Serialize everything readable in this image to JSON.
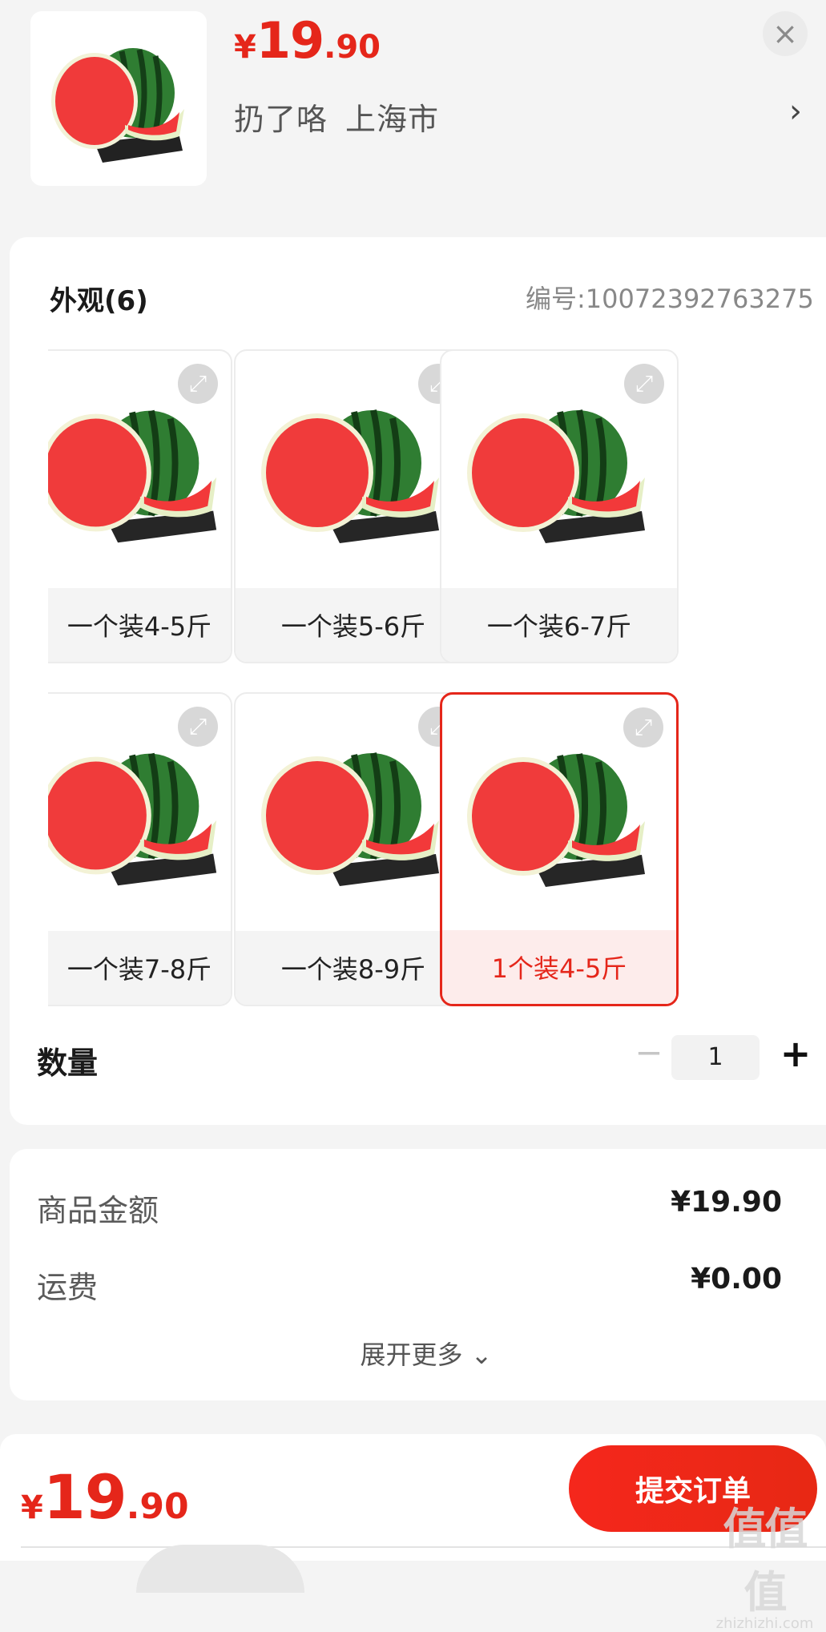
{
  "header": {
    "price": {
      "currency": "¥",
      "integer": "19",
      "decimal": ".90"
    },
    "address": {
      "name": "扔了咯",
      "city": "上海市"
    },
    "chevron": "›",
    "close": "×"
  },
  "variants": {
    "title": "外观(6)",
    "sku": "编号:100723927632​75",
    "items": [
      {
        "label": "一个装4-5斤",
        "selected": false
      },
      {
        "label": "一个装5-6斤",
        "selected": false
      },
      {
        "label": "一个装6-7斤",
        "selected": false
      },
      {
        "label": "一个装7-8斤",
        "selected": false
      },
      {
        "label": "一个装8-9斤",
        "selected": false
      },
      {
        "label": "1个装4-5斤",
        "selected": true
      }
    ],
    "expand_icon": "⤢"
  },
  "quantity": {
    "label": "数量",
    "value": "1",
    "minus": "−",
    "plus": "+"
  },
  "fees": {
    "rows": [
      {
        "label": "商品金额",
        "value": "¥19.90"
      },
      {
        "label": "运费",
        "value": "¥0.00"
      }
    ],
    "expand_more": "展开更多 ⌄"
  },
  "bottom": {
    "price": {
      "currency": "¥",
      "integer": "19",
      "decimal": ".90"
    },
    "submit": "提交订单"
  },
  "watermark": {
    "line1": "值值值",
    "line2": "zhizhizhi.com"
  }
}
